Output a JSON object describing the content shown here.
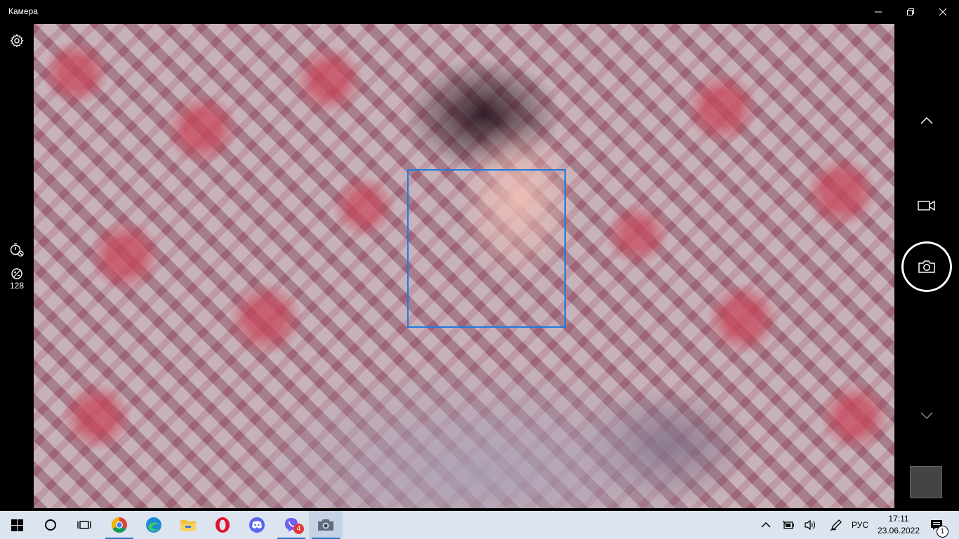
{
  "window": {
    "title": "Камера",
    "minimize_icon": "minimize-icon",
    "restore_icon": "restore-icon",
    "close_icon": "close-icon"
  },
  "left_rail": {
    "settings_icon": "gear-icon",
    "timer_icon": "timer-off-icon",
    "iso_icon": "iso-icon",
    "iso_value": "128"
  },
  "viewfinder": {
    "face_box_color": "#1e7be0"
  },
  "right_rail": {
    "scroll_up_icon": "chevron-up-icon",
    "video_mode_icon": "video-camera-icon",
    "shutter_icon": "camera-icon",
    "scroll_down_icon": "chevron-down-icon"
  },
  "taskbar": {
    "apps": [
      {
        "name": "Windows Start",
        "icon": "windows-icon"
      },
      {
        "name": "Search",
        "icon": "search-circle-icon"
      },
      {
        "name": "Task View",
        "icon": "task-view-icon"
      },
      {
        "name": "Google Chrome",
        "icon": "chrome-icon"
      },
      {
        "name": "Microsoft Edge",
        "icon": "edge-icon"
      },
      {
        "name": "File Explorer",
        "icon": "folder-icon"
      },
      {
        "name": "Opera",
        "icon": "opera-icon"
      },
      {
        "name": "Discord",
        "icon": "discord-icon"
      },
      {
        "name": "Viber",
        "icon": "viber-icon",
        "badge": "4"
      },
      {
        "name": "Камера",
        "icon": "camera-icon"
      }
    ],
    "tray": {
      "language": "РУС",
      "time": "17:11",
      "date": "23.06.2022",
      "notifications_count": "1"
    }
  },
  "colors": {
    "accent": "#2a73c9",
    "taskbar_bg": "#dce4ef",
    "badge": "#e53935"
  }
}
